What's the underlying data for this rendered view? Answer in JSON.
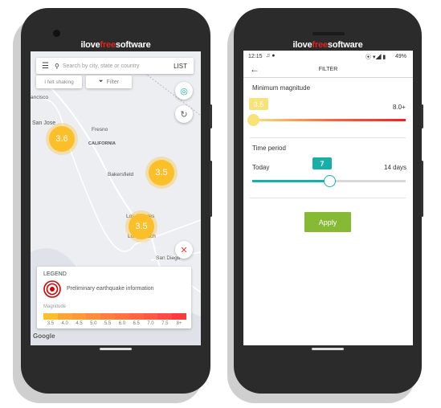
{
  "watermark": {
    "pre": "ilove",
    "mid": "free",
    "post": "software"
  },
  "map_screen": {
    "search": {
      "placeholder": "Search by city, state or country",
      "list_label": "LIST"
    },
    "chips": {
      "felt": "I felt shaking",
      "filter": "Filter"
    },
    "places": [
      "ancisco",
      "San Jose",
      "Fresno",
      "CALIFORNIA",
      "Bakersfield",
      "Los Angeles",
      "Long Beach",
      "San Diego"
    ],
    "clusters": [
      "3.6",
      "3.5",
      "3.5"
    ],
    "legend": {
      "title": "LEGEND",
      "item": "Preliminary earthquake information",
      "scale_label": "Magnitude",
      "ticks": [
        "3.5",
        "4.0",
        "4.5",
        "5.0",
        "5.5",
        "6.0",
        "6.5",
        "7.0",
        "7.5",
        "8+"
      ],
      "colors": [
        "#fbbf2a",
        "#fca532",
        "#fc9a36",
        "#fc8d3a",
        "#fc803d",
        "#fc7440",
        "#fc6742",
        "#fc5a42",
        "#fc4b42",
        "#fc3b3f"
      ]
    },
    "attribution": "Google",
    "icons": [
      "menu-icon",
      "search-icon",
      "filter-icon",
      "my-location-icon",
      "refresh-icon",
      "close-icon"
    ]
  },
  "filter_screen": {
    "status": {
      "time": "12:15",
      "battery": "49%"
    },
    "title": "FILTER",
    "magnitude": {
      "label": "Minimum magnitude",
      "value": "3.5",
      "max_label": "8.0+",
      "fraction": 0
    },
    "time_period": {
      "label": "Time period",
      "min_label": "Today",
      "max_label": "14 days",
      "value": "7",
      "fraction": 0.5
    },
    "apply": "Apply",
    "colors": {
      "teal": "#18b0a6",
      "apply": "#86b934",
      "mag_thumb": "#f8e37a"
    }
  }
}
